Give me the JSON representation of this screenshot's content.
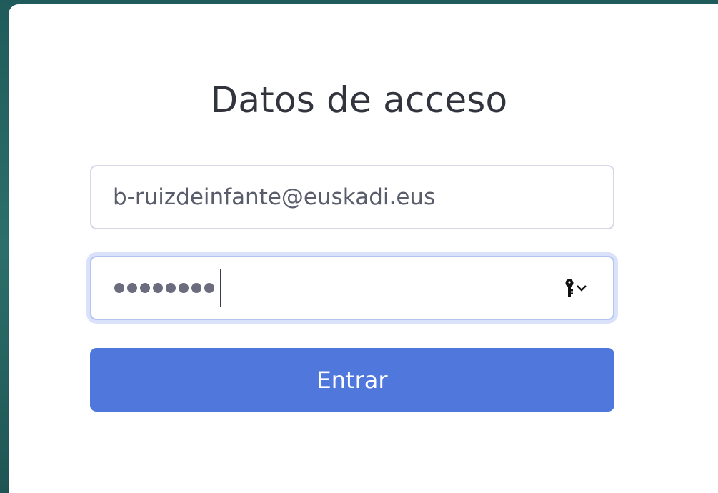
{
  "login": {
    "title": "Datos de acceso",
    "email_value": "b-ruizdeinfante@euskadi.eus",
    "password_mask": "••••••••",
    "password_length": 8,
    "password_icon": "key-icon",
    "submit_label": "Entrar"
  },
  "colors": {
    "background": "#2c6f6a",
    "card": "#ffffff",
    "accent": "#5077dc",
    "title_text": "#32343d",
    "focus_ring": "#d9e2fa"
  }
}
